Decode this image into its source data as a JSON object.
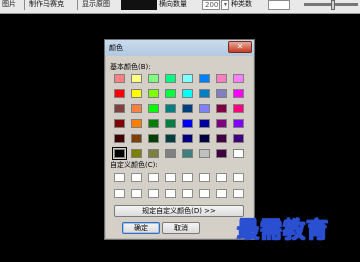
{
  "toolbar": {
    "item1": "图片",
    "item2": "制作马赛克",
    "item3": "显示原图",
    "label_gradient": "横向数量",
    "gradient_value": "200",
    "label_type": "种类数"
  },
  "dialog": {
    "title": "颜色",
    "close_symbol": "✕",
    "basic_label": "基本颜色(B):",
    "custom_label": "自定义颜色(C):",
    "define_custom_button": "规定自定义颜色(D) >>",
    "ok_button": "确定",
    "cancel_button": "取消",
    "basic_colors": [
      "#ff8080",
      "#ffff80",
      "#80ff80",
      "#00ff80",
      "#80ffff",
      "#0080ff",
      "#ff80c0",
      "#ff80ff",
      "#ff0000",
      "#ffff00",
      "#80ff00",
      "#00ff40",
      "#00ffff",
      "#0080c0",
      "#8080c0",
      "#ff00ff",
      "#804040",
      "#ff8040",
      "#00ff00",
      "#008080",
      "#004080",
      "#8080ff",
      "#800040",
      "#ff0080",
      "#800000",
      "#ff8000",
      "#008000",
      "#008040",
      "#0000ff",
      "#0000a0",
      "#800080",
      "#8000ff",
      "#400000",
      "#804000",
      "#004000",
      "#004040",
      "#000080",
      "#000040",
      "#400040",
      "#400080",
      "#000000",
      "#808000",
      "#808040",
      "#808080",
      "#408080",
      "#c0c0c0",
      "#400040",
      "#ffffff"
    ],
    "selected_index": 40,
    "custom_count": 16
  },
  "watermark": {
    "text": "最需教育"
  }
}
